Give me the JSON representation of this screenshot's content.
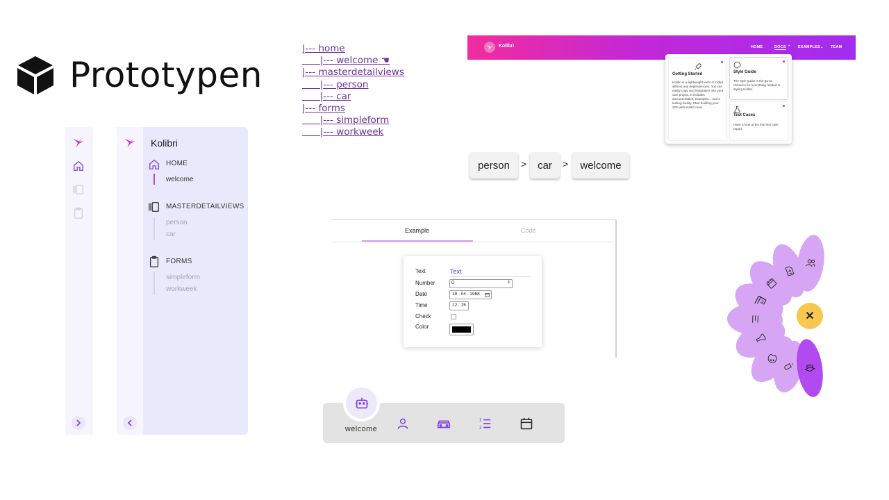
{
  "title": "Prototypen",
  "sidebar": {
    "app_name": "Kolibri",
    "groups": [
      {
        "label": "HOME",
        "items": [
          "welcome"
        ]
      },
      {
        "label": "MASTERDETAILVIEWS",
        "items": [
          "person",
          "car"
        ]
      },
      {
        "label": "FORMS",
        "items": [
          "simpleform",
          "workweek"
        ]
      }
    ]
  },
  "tree": [
    "|--- home",
    "      |--- welcome ☚",
    "|--- masterdetailviews",
    "      |--- person",
    "      |--- car",
    "|--- forms",
    "      |--- simpleform",
    "      |--- workweek"
  ],
  "header": {
    "brand": "Kolibri",
    "nav": [
      "HOME",
      "DOCS",
      "EXAMPLES",
      "TEAM"
    ],
    "gradient": [
      "#f12c9e",
      "#a22cf0"
    ],
    "cards": [
      {
        "title": "Getting Started",
        "desc": "Kolibri is a lightweight web UI toolkit without any dependencies. You can easily copy and integrate it into your own project. It includes documentation, examples... and a testing facility. Start building your SPA with Kolibri now!"
      },
      {
        "title": "Style Guide",
        "desc": "The style guide is the go-to resource for everything related to styling Kolibri."
      },
      {
        "title": "Test Cases",
        "desc": "Have a look at the live test case report."
      }
    ]
  },
  "breadcrumb": [
    "person",
    "car",
    "welcome"
  ],
  "breadcrumb_separator": ">",
  "form_example": {
    "tabs": [
      "Example",
      "Code"
    ],
    "active_tab": "Example",
    "fields": [
      {
        "label": "Text",
        "value": "Text"
      },
      {
        "label": "Number",
        "value": "0"
      },
      {
        "label": "Date",
        "value": "19 . 04 . 1968"
      },
      {
        "label": "Time",
        "value": "12 : 15"
      },
      {
        "label": "Check",
        "value": ""
      },
      {
        "label": "Color",
        "value": "#000000"
      }
    ]
  },
  "flower": {
    "close_label": "✕",
    "accent": "#f9c74f",
    "petal_color": "#d6a6f5",
    "active_petal_color": "#b14af0"
  },
  "bottom_nav": {
    "active_label": "welcome",
    "accent": "#7b3fe4"
  },
  "colors": {
    "accent_purple": "#a34fe8",
    "link": "#6b2f99"
  }
}
